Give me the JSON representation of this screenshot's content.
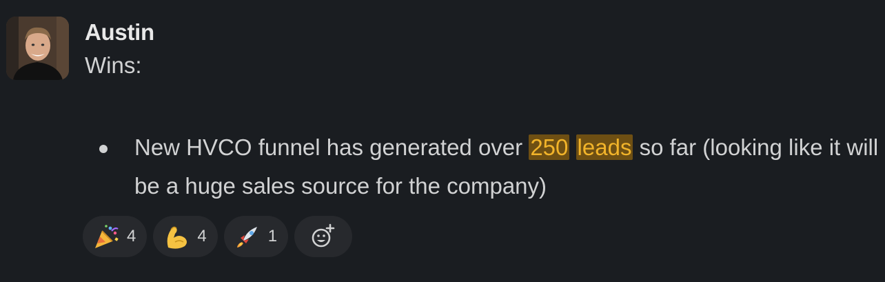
{
  "message": {
    "author": "Austin",
    "intro": "Wins:",
    "bullets": [
      {
        "before": "New HVCO funnel has generated over ",
        "highlight_1": "250",
        "between": " ",
        "highlight_2": "leads",
        "after": " so far (looking like it will be a huge sales source for the company)"
      }
    ]
  },
  "reactions": [
    {
      "emoji": "party-popper-icon",
      "count": "4"
    },
    {
      "emoji": "flexed-biceps-icon",
      "count": "4"
    },
    {
      "emoji": "rocket-icon",
      "count": "1"
    }
  ],
  "colors": {
    "background": "#1a1d21",
    "text": "#d1d2d3",
    "highlight_bg": "#6e4f13",
    "highlight_fg": "#f2b42a",
    "pill": "#27292d"
  }
}
